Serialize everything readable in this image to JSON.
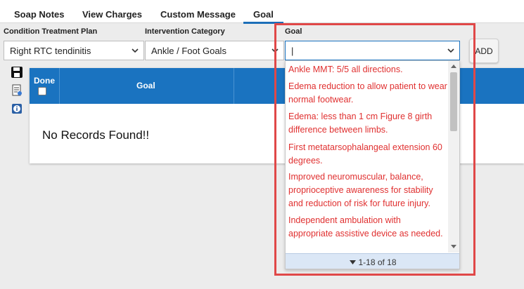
{
  "tabs": [
    {
      "label": "Soap Notes"
    },
    {
      "label": "View Charges"
    },
    {
      "label": "Custom Message"
    },
    {
      "label": "Goal"
    }
  ],
  "form": {
    "condition_label": "Condition Treatment Plan",
    "condition_value": "Right RTC tendinitis",
    "intervention_label": "Intervention Category",
    "intervention_value": "Ankle / Foot Goals",
    "goal_label": "Goal",
    "goal_value": "|",
    "add_label": "ADD"
  },
  "grid": {
    "col_done": "Done",
    "col_goal": "Goal",
    "empty_text": "No Records Found!!"
  },
  "dropdown": {
    "items": [
      "Ankle MMT: 5/5 all directions.",
      "Edema reduction to allow patient to wear normal footwear.",
      "Edema: less than 1 cm Figure 8 girth difference between limbs.",
      "First metatarsophalangeal extension 60 degrees.",
      "Improved neuromuscular, balance, proprioceptive awareness for stability and reduction of risk for future injury.",
      "Independent ambulation with appropriate assistive device as needed."
    ],
    "pager": "1-18 of 18",
    "item_color": "#e03030"
  },
  "colors": {
    "header_blue": "#1a73c0",
    "highlight_red": "#e04848"
  }
}
